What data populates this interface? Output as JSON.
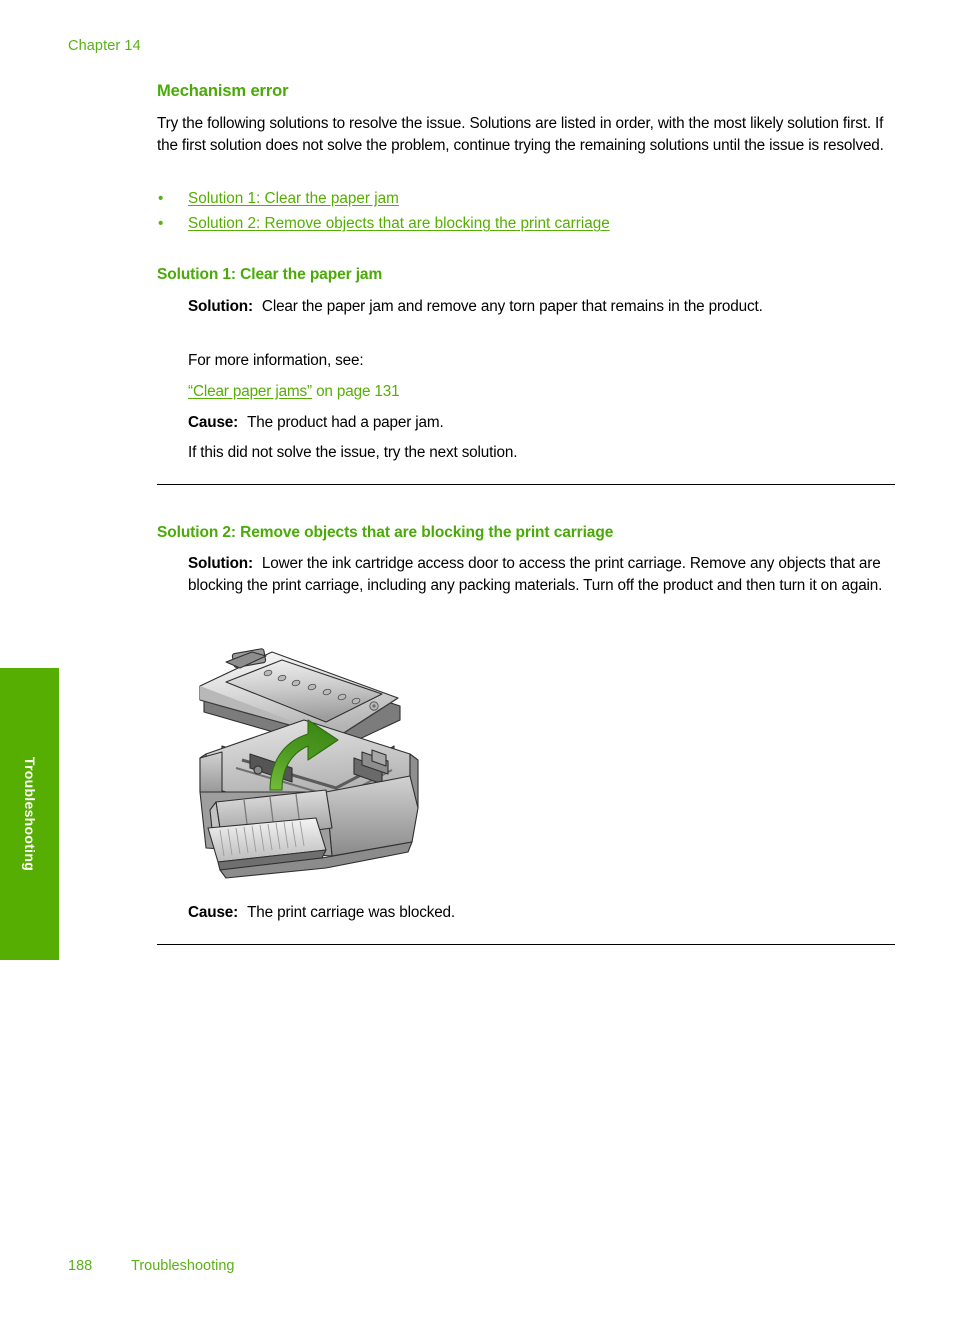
{
  "page": {
    "running_head": "Chapter 14",
    "footer_page_number": "188",
    "footer_section": "Troubleshooting",
    "side_tab_label": "Troubleshooting",
    "accent_green": "#56ae02",
    "heading_green": "#4aaa07",
    "link_green": "#56ae02",
    "text_black": "#000000"
  },
  "section": {
    "title": "Mechanism error",
    "intro": "Try the following solutions to resolve the issue. Solutions are listed in order, with the most likely solution first. If the first solution does not solve the problem, continue trying the remaining solutions until the issue is resolved.",
    "links": [
      {
        "label": "Solution 1: Clear the paper jam",
        "bullet": "•"
      },
      {
        "label": "Solution 2: Remove objects that are blocking the print carriage",
        "bullet": "•"
      }
    ]
  },
  "solution1": {
    "title": "Solution 1: Clear the paper jam",
    "solution_label": "Solution:",
    "solution_text": "Clear the paper jam and remove any torn paper that remains in the product.",
    "more_info": "For more information, see:",
    "xref_link": "“Clear paper jams”",
    "xref_suffix": " on page 131",
    "cause_label": "Cause:",
    "cause_text": "The product had a paper jam.",
    "next_step": "If this did not solve the issue, try the next solution."
  },
  "solution2": {
    "title": "Solution 2: Remove objects that are blocking the print carriage",
    "solution_label": "Solution:",
    "solution_text": "Lower the ink cartridge access door to access the print carriage. Remove any objects that are blocking the print carriage, including any packing materials. Turn off the product and then turn it on again.",
    "figure_alt": "All-in-one printer with scanner lid raised and a curved green arrow indicating the opening motion",
    "cause_label": "Cause:",
    "cause_text": "The print carriage was blocked."
  }
}
